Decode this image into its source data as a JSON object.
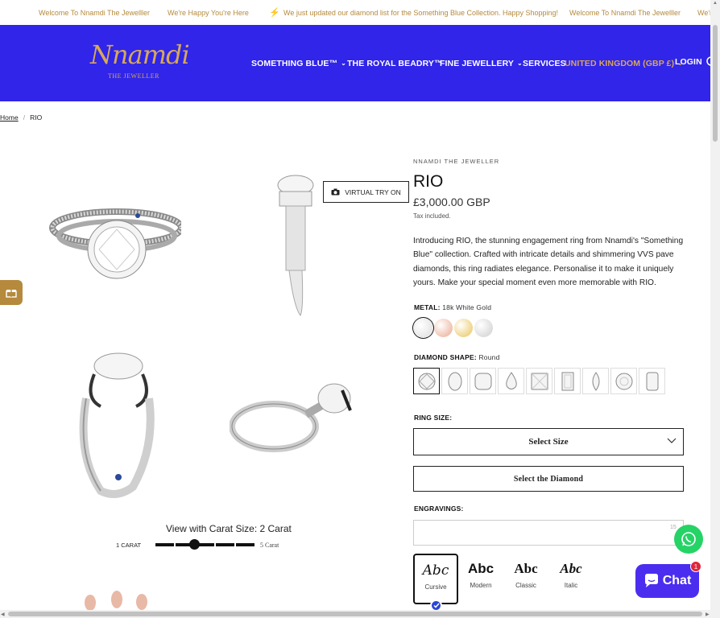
{
  "announcement": {
    "items": [
      "Welcome To Nnamdi The Jewelller",
      "We're Happy You're Here",
      "We just updated our diamond list for the Something Blue Collection. Happy Shopping!",
      "Welcome To Nnamdi The Jewelller",
      "We're"
    ]
  },
  "header": {
    "logo_script": "Nnamdi",
    "logo_sub": "THE JEWELLER",
    "nav": [
      {
        "label": "SOMETHING BLUE™"
      },
      {
        "label": "THE ROYAL BEADRY™"
      },
      {
        "label": "FINE JEWELLERY"
      },
      {
        "label": "SERVICES"
      },
      {
        "label": "UNITED KINGDOM (GBP £)"
      },
      {
        "label": "LOGIN"
      }
    ]
  },
  "breadcrumb": {
    "home": "Home",
    "current": "RIO"
  },
  "gallery": {
    "virtual_try_on": "VIRTUAL TRY ON",
    "carat_title": "View with Carat Size: 2 Carat",
    "carat_min": "1 CARAT",
    "carat_max": "5 Carat",
    "carat_selected_fraction": 0.25
  },
  "product": {
    "brand": "NNAMDI THE JEWELLER",
    "title": "RIO",
    "price": "£3,000.00 GBP",
    "tax": "Tax included.",
    "description": "Introducing RIO, the stunning engagement ring from Nnamdi's \"Something Blue\" collection. Crafted with intricate details and shimmering VVS pave diamonds, this ring radiates elegance. Personalise it to make it uniquely yours. Make your special moment even more memorable with RIO.",
    "metal_label": "METAL:",
    "metal_value": "18k White Gold",
    "metal_colors": [
      "#e8e8e8",
      "#f0c2b0",
      "#efd58a",
      "#dcdcdc"
    ],
    "shape_label": "DIAMOND SHAPE:",
    "shape_value": "Round",
    "ring_size_label": "RING SIZE:",
    "select_size": "Select Size",
    "select_diamond": "Select the Diamond",
    "engravings_label": "ENGRAVINGS:",
    "engrave_count": "15",
    "fonts": [
      {
        "sample": "Abc",
        "name": "Cursive"
      },
      {
        "sample": "Abc",
        "name": "Modern"
      },
      {
        "sample": "Abc",
        "name": "Classic"
      },
      {
        "sample": "Abc",
        "name": "Italic"
      }
    ]
  },
  "chat": {
    "label": "Chat",
    "badge": "1"
  },
  "colors": {
    "header_bg": "#3025e8",
    "gold": "#b58a3c",
    "chat": "#4b2df0",
    "whatsapp": "#25d366"
  }
}
